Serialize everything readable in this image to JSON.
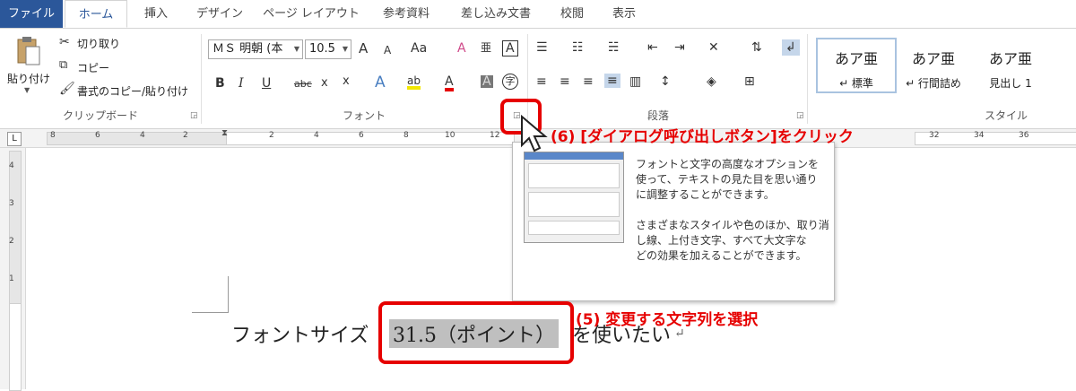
{
  "tabs": [
    "ファイル",
    "ホーム",
    "挿入",
    "デザイン",
    "ページ レイアウト",
    "参考資料",
    "差し込み文書",
    "校閲",
    "表示"
  ],
  "clipboard": {
    "paste": "貼り付け",
    "cut": "切り取り",
    "copy": "コピー",
    "format_painter": "書式のコピー/貼り付け",
    "group_label": "クリップボード"
  },
  "font": {
    "font_name": "ＭＳ 明朝 (本",
    "font_size": "10.5",
    "grow": "A",
    "shrink": "A",
    "case": "Aa",
    "clear": "A",
    "phonetic": "亜",
    "border_char": "A",
    "bold": "B",
    "italic": "I",
    "underline": "U",
    "strike": "abc",
    "subscript": "x",
    "superscript": "x",
    "effects": "A",
    "highlight": "ab",
    "font_color": "A",
    "shading": "A",
    "enclose": "字",
    "group_label": "フォント"
  },
  "paragraph": {
    "group_label": "段落"
  },
  "styles": {
    "items": [
      {
        "sample": "あア亜",
        "label": "↵ 標準"
      },
      {
        "sample": "あア亜",
        "label": "↵ 行間詰め"
      },
      {
        "sample": "あア亜",
        "label": "見出し 1"
      }
    ],
    "group_label": "スタイル"
  },
  "ruler": {
    "corner": "L",
    "left_numbers": [
      "8",
      "6",
      "4",
      "2"
    ],
    "right_numbers": [
      "2",
      "4",
      "6",
      "8",
      "10",
      "12"
    ],
    "far_numbers": [
      "32",
      "34",
      "36"
    ]
  },
  "vruler": {
    "numbers": [
      "4",
      "3",
      "2",
      "1"
    ]
  },
  "tooltip": {
    "line1": "フォントと文字の高度なオプションを",
    "line2": "使って、テキストの見た目を思い通り",
    "line3": "に調整することができます。",
    "line4": "さまざまなスタイルや色のほか、取り消",
    "line5": "し線、上付き文字、すべて大文字な",
    "line6": "どの効果を加えることができます。"
  },
  "annotations": {
    "step6": "(6) [ダイアログ呼び出しボタン]をクリック",
    "step5": "(5) 変更する文字列を選択"
  },
  "document": {
    "before": "フォントサイズ",
    "selected": "31.5（ポイント）",
    "after": "を使いたい",
    "mark": "↵"
  },
  "colors": {
    "accent": "#2b579a",
    "annotation": "#e60000",
    "highlight": "#f2e600",
    "font_color": "#e60000"
  }
}
